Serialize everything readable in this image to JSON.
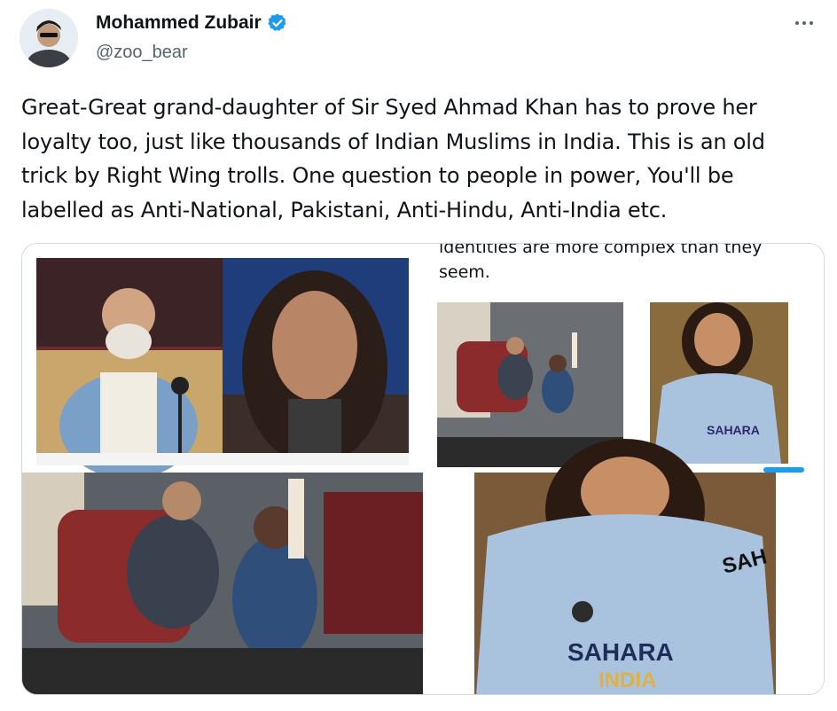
{
  "author": {
    "display_name": "Mohammed Zubair",
    "handle": "@zoo_bear",
    "verified": true,
    "avatar_icon": "profile-avatar"
  },
  "menu": {
    "icon": "more-options-icon"
  },
  "tweet": {
    "text": "Great-Great grand-daughter of Sir Syed Ahmad Khan has to prove her loyalty too, just like thousands of Indian Muslims in India. This is an old trick by Right Wing trolls. One question to people in power, You'll be labelled as Anti-National, Pakistani, Anti-Hindu, Anti-India etc."
  },
  "media": {
    "caption_line1": "identities are more complex than they",
    "caption_line2": "seem.",
    "jersey_text_1": "SAHARA",
    "jersey_text_2": "INDIA",
    "sleeve_text": "SAH"
  },
  "colors": {
    "verified_blue": "#1d9bf0",
    "text_primary": "#0f1419",
    "text_secondary": "#536471",
    "border": "#cfd9de"
  }
}
